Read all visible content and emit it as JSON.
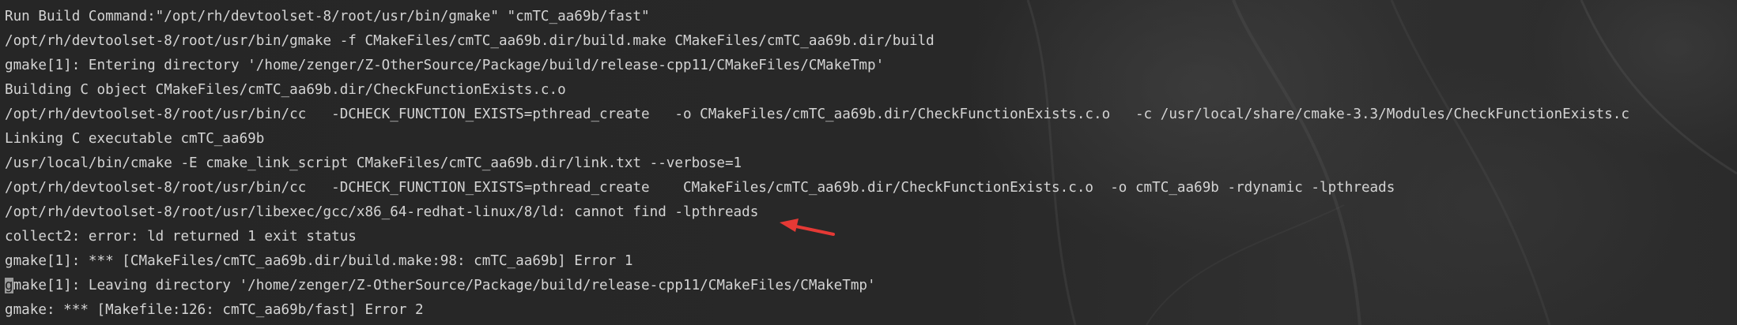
{
  "terminal": {
    "lines": [
      "Run Build Command:\"/opt/rh/devtoolset-8/root/usr/bin/gmake\" \"cmTC_aa69b/fast\"",
      "/opt/rh/devtoolset-8/root/usr/bin/gmake -f CMakeFiles/cmTC_aa69b.dir/build.make CMakeFiles/cmTC_aa69b.dir/build",
      "gmake[1]: Entering directory '/home/zenger/Z-OtherSource/Package/build/release-cpp11/CMakeFiles/CMakeTmp'",
      "Building C object CMakeFiles/cmTC_aa69b.dir/CheckFunctionExists.c.o",
      "/opt/rh/devtoolset-8/root/usr/bin/cc   -DCHECK_FUNCTION_EXISTS=pthread_create   -o CMakeFiles/cmTC_aa69b.dir/CheckFunctionExists.c.o   -c /usr/local/share/cmake-3.3/Modules/CheckFunctionExists.c",
      "Linking C executable cmTC_aa69b",
      "/usr/local/bin/cmake -E cmake_link_script CMakeFiles/cmTC_aa69b.dir/link.txt --verbose=1",
      "/opt/rh/devtoolset-8/root/usr/bin/cc   -DCHECK_FUNCTION_EXISTS=pthread_create    CMakeFiles/cmTC_aa69b.dir/CheckFunctionExists.c.o  -o cmTC_aa69b -rdynamic -lpthreads",
      "/opt/rh/devtoolset-8/root/usr/libexec/gcc/x86_64-redhat-linux/8/ld: cannot find -lpthreads",
      "collect2: error: ld returned 1 exit status",
      "gmake[1]: *** [CMakeFiles/cmTC_aa69b.dir/build.make:98: cmTC_aa69b] Error 1",
      "gmake[1]: Leaving directory '/home/zenger/Z-OtherSource/Package/build/release-cpp11/CMakeFiles/CMakeTmp'",
      "gmake: *** [Makefile:126: cmTC_aa69b/fast] Error 2"
    ],
    "cursor_line_first_char": "g",
    "cursor_line_rest": "make[1]: Leaving directory '/home/zenger/Z-OtherSource/Package/build/release-cpp11/CMakeFiles/CMakeTmp'",
    "text_color": "#d4d4d4",
    "background_color": "#262626"
  },
  "annotation": {
    "type": "arrow",
    "color": "#e53935"
  }
}
